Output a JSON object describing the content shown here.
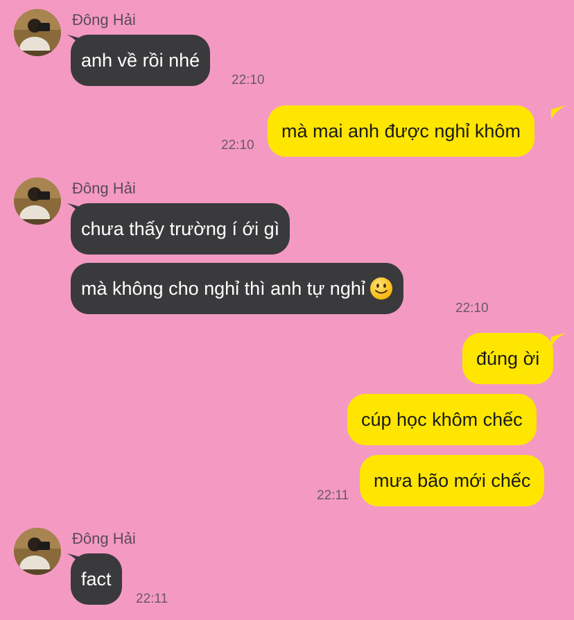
{
  "chat": {
    "sender_name": "Đông Hải",
    "colors": {
      "background": "#f49ac2",
      "incoming_bubble": "#3a3a3c",
      "outgoing_bubble": "#ffe600"
    },
    "messages": [
      {
        "direction": "in",
        "text": "anh về rồi nhé",
        "time": "22:10"
      },
      {
        "direction": "out",
        "text": "mà mai anh được nghỉ khôm",
        "time": "22:10"
      },
      {
        "direction": "in",
        "text": "chưa thấy trường í ới gì"
      },
      {
        "direction": "in",
        "text": "mà không cho nghỉ thì anh tự nghỉ",
        "emoji": "slightly-smiling-face-icon",
        "time": "22:10"
      },
      {
        "direction": "out",
        "text": "đúng ời"
      },
      {
        "direction": "out",
        "text": "cúp học khôm chếc"
      },
      {
        "direction": "out",
        "text": "mưa bão mới chếc",
        "time": "22:11"
      },
      {
        "direction": "in",
        "text": "fact",
        "time": "22:11"
      }
    ]
  }
}
